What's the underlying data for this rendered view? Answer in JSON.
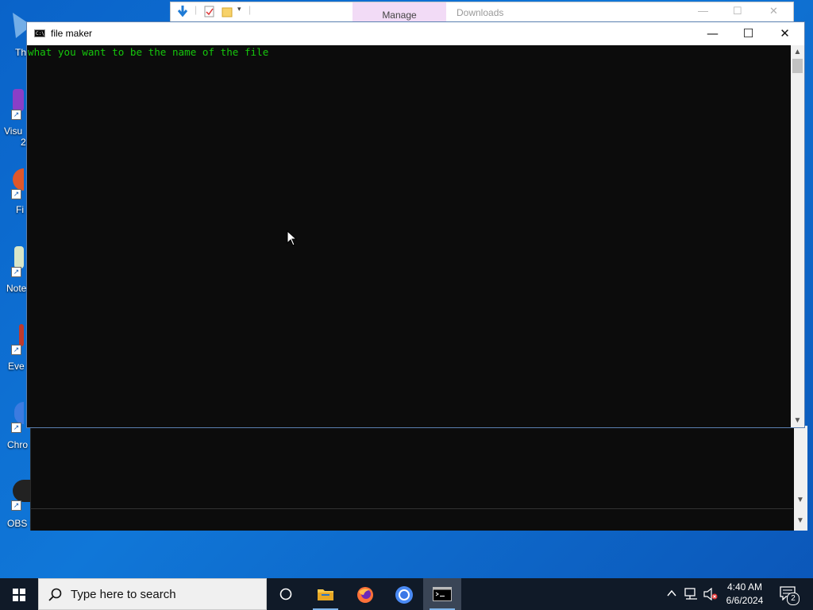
{
  "desktop": {
    "icons": [
      {
        "label": "Th",
        "color": "#5aa0e0"
      },
      {
        "label": "Visu",
        "color": "#8a3fc7"
      },
      {
        "label": "Fi",
        "color": "#e0572a"
      },
      {
        "label": "Note",
        "color": "#6aa84f"
      },
      {
        "label": "Eve",
        "color": "#c0392b"
      },
      {
        "label": "Chro",
        "color": "#3c7be0"
      },
      {
        "label": "OBS S",
        "color": "#222222"
      }
    ],
    "icon_sublabel_2": "2"
  },
  "explorer_bg": {
    "manage_label": "Manage",
    "location_label": "Downloads"
  },
  "cmd_window": {
    "title": "file maker",
    "output_line": "what you want to be the name of the file",
    "minimize_symbol": "—",
    "maximize_symbol": "☐",
    "close_symbol": "✕"
  },
  "taskbar": {
    "search_placeholder": "Type here to search",
    "time": "4:40 AM",
    "date": "6/6/2024",
    "notification_count": "2",
    "pinned": [
      {
        "name": "task-view",
        "icon": "circle-icon"
      },
      {
        "name": "file-explorer",
        "icon": "folder-icon",
        "running": true
      },
      {
        "name": "firefox",
        "icon": "firefox-icon"
      },
      {
        "name": "chrome",
        "icon": "chrome-icon"
      },
      {
        "name": "command-prompt",
        "icon": "terminal-icon",
        "running": true,
        "active": true
      }
    ]
  },
  "colors": {
    "console_text": "#16c60c",
    "console_bg": "#0c0c0c",
    "taskbar_bg": "#101a28",
    "desktop_bg": "#0a63c9"
  }
}
